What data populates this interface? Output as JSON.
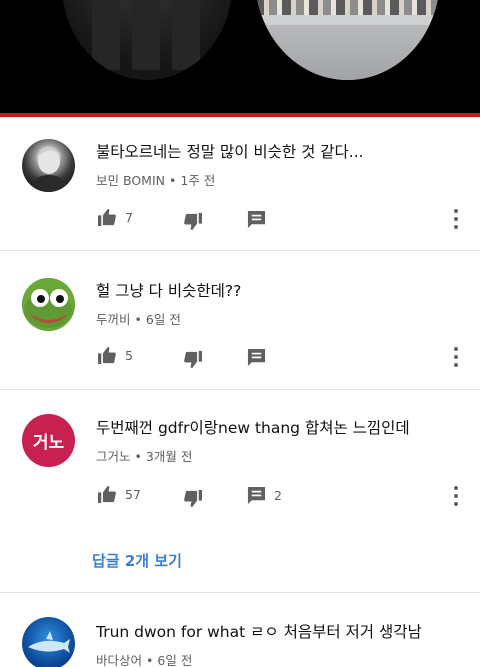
{
  "video": {
    "progress_fraction": 1.0,
    "progress_color": "#cc1a1a"
  },
  "comments": [
    {
      "author": "보민 BOMIN",
      "time": "1주 전",
      "text": "불타오르네는 정말 많이 비슷한 것 같다...",
      "likes": "7",
      "replies": ""
    },
    {
      "author": "두꺼비",
      "time": "6일 전",
      "text": "헐 그냥 다 비슷한데??",
      "likes": "5",
      "replies": ""
    },
    {
      "author": "그거노",
      "avatar_text": "거노",
      "avatar_color": "#c8204f",
      "time": "3개월 전",
      "text": "두번째껀 gdfr이랑new thang 합쳐논 느낌인데",
      "likes": "57",
      "replies": "2",
      "view_replies_label": "답글 2개 보기"
    },
    {
      "author": "바다상어",
      "time": "6일 전",
      "text": "Trun dwon for what ㄹㅇ 처음부터 저거 생각남",
      "likes": "",
      "replies": ""
    }
  ],
  "meta_separator": "•",
  "accent_link_color": "#3d7fd2"
}
